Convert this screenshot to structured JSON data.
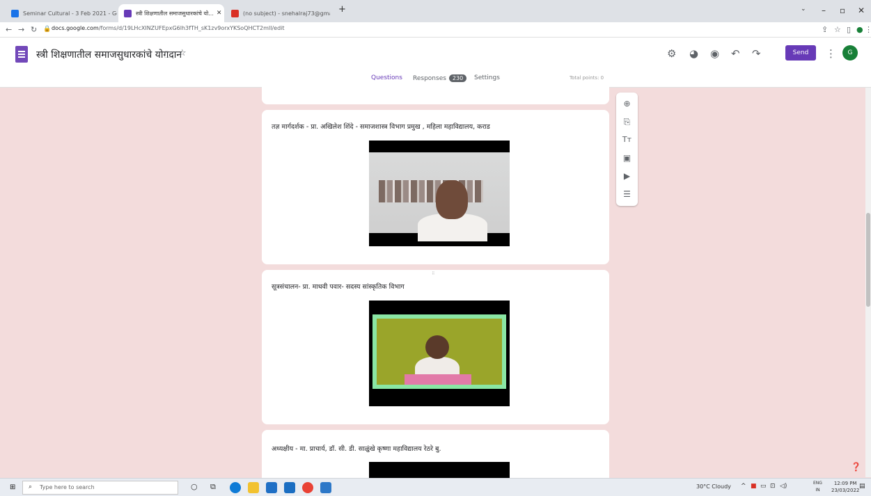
{
  "browser": {
    "tabs": [
      {
        "title": "Seminar Cultural - 3 Feb 2021 - Go...",
        "favicon_color": "#1a73e8"
      },
      {
        "title": "स्त्री शिक्षणातील समाजसुधारकांचे यो...",
        "favicon_color": "#673ab7"
      },
      {
        "title": "(no subject) - snehalraj73@gmai...",
        "favicon_color": "#d93025"
      }
    ],
    "new_tab_label": "+",
    "url_domain": "docs.google.com",
    "url_path": "/forms/d/19LHcXINZUFEpxG6lh3fTH_sK1zv9orxYKSoQHCT2mlI/edit"
  },
  "form": {
    "title": "स्त्री शिक्षणातील समाजसुधारकांचे योगदान",
    "send_label": "Send",
    "avatar_letter": "G",
    "tabs": {
      "questions": "Questions",
      "responses": "Responses",
      "responses_count": "230",
      "settings": "Settings"
    },
    "total_points": "Total points: 0"
  },
  "cards": [
    {
      "title": "तज्ञ मार्गदर्शक - प्रा. अखिलेश शिंदे - समाजशास्त्र विभाग प्रमुख , महिला महाविद्यालय, कराड"
    },
    {
      "title": "सूत्रसंचालन- प्रा. माधवी पवार- सदस्य सांस्कृतिक विभाग"
    },
    {
      "title": "अध्यक्षीय - मा. प्राचार्य, डॉ. सी. डी. साळुंखे कृष्णा महाविद्यालय रेठरे बु."
    }
  ],
  "taskbar": {
    "search_placeholder": "Type here to search",
    "weather": "30°C Cloudy",
    "lang_top": "ENG",
    "lang_bottom": "IN",
    "time": "12:09 PM",
    "date": "23/03/2022"
  }
}
